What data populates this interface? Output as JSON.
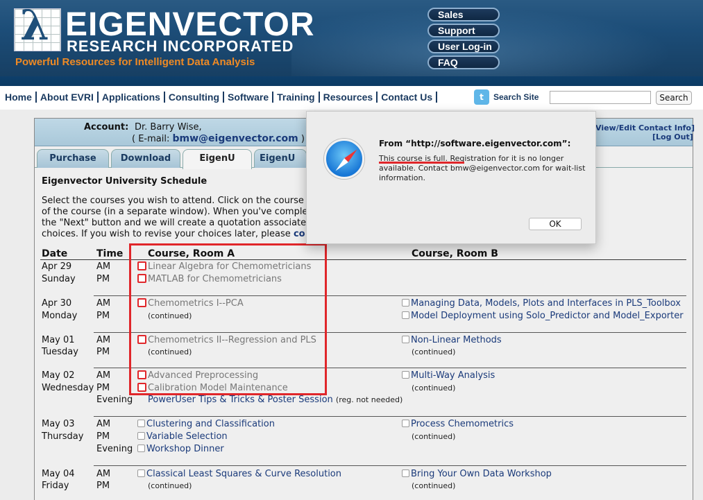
{
  "banner": {
    "logo_name": "EIGENVECTOR",
    "logo_sub": "RESEARCH INCORPORATED",
    "tagline": "Powerful Resources for Intelligent Data Analysis",
    "pill_links": [
      "Sales",
      "Support",
      "User Log-in",
      "FAQ"
    ]
  },
  "nav": {
    "items": [
      "Home",
      "About EVRI",
      "Applications",
      "Consulting",
      "Software",
      "Training",
      "Resources",
      "Contact Us"
    ],
    "search_label": "Search Site",
    "search_button": "Search",
    "search_value": ""
  },
  "account": {
    "label": "Account:",
    "name": "Dr. Barry Wise,",
    "email_prefix": "( E-mail:",
    "email": "bmw@eigenvector.com",
    "email_suffix": ")",
    "contact_link": "View/Edit Contact Info]",
    "logout_link": "[Log Out]"
  },
  "tabs": [
    "Purchase",
    "Download",
    "EigenU",
    "EigenU On"
  ],
  "schedule": {
    "title": "Eigenvector University Schedule",
    "intro": [
      "Select the courses you wish to attend. Click on the course",
      "of the course (in a separate window). When you've comple",
      "the \"Next\" button and we will create a quotation associate",
      "choices. If you wish to revise your choices later, please"
    ],
    "intro_link": "co",
    "headers": {
      "date": "Date",
      "time": "Time",
      "room_a": "Course, Room A",
      "room_b": "Course, Room B"
    },
    "continued": "(continued)",
    "days": [
      {
        "date": "Apr 29",
        "weekday": "Sunday",
        "am": "AM",
        "pm": "PM",
        "a_am": "Linear Algebra for Chemometricians",
        "a_pm": "MATLAB for Chemometricians"
      },
      {
        "date": "Apr 30",
        "weekday": "Monday",
        "am": "AM",
        "pm": "PM",
        "a_am": "Chemometrics I--PCA",
        "b_am": "Managing Data, Models, Plots and Interfaces in PLS_Toolbox",
        "b_pm": "Model Deployment using Solo_Predictor and Model_Exporter"
      },
      {
        "date": "May 01",
        "weekday": "Tuesday",
        "am": "AM",
        "pm": "PM",
        "a_am": "Chemometrics II--Regression and PLS",
        "b_am": "Non-Linear Methods"
      },
      {
        "date": "May 02",
        "weekday": "Wednesday",
        "am": "AM",
        "pm": "PM",
        "evening": "Evening",
        "a_am": "Advanced Preprocessing",
        "a_pm": "Calibration Model Maintenance",
        "a_eve": "PowerUser Tips & Tricks & Poster Session",
        "a_eve_note": "(reg. not needed)",
        "b_am": "Multi-Way Analysis"
      },
      {
        "date": "May 03",
        "weekday": "Thursday",
        "am": "AM",
        "pm": "PM",
        "evening": "Evening",
        "a_am": "Clustering and Classification",
        "a_pm": "Variable Selection",
        "a_eve": "Workshop Dinner",
        "b_am": "Process Chemometrics"
      },
      {
        "date": "May 04",
        "weekday": "Friday",
        "am": "AM",
        "pm": "PM",
        "a_am": "Classical Least Squares & Curve Resolution",
        "b_am": "Bring Your Own Data Workshop"
      }
    ]
  },
  "dialog": {
    "title": "From “http://software.eigenvector.com”:",
    "message_lines": [
      "This course is full. Registration for it is no longer",
      "available. Contact bmw@eigenvector.com for wait-list",
      "information."
    ],
    "ok_label": "OK"
  },
  "colors": {
    "accent_red": "#e0262a",
    "link_blue": "#1a3a7a",
    "banner_blue": "#1c4d78",
    "tagline_orange": "#ef8a24"
  }
}
